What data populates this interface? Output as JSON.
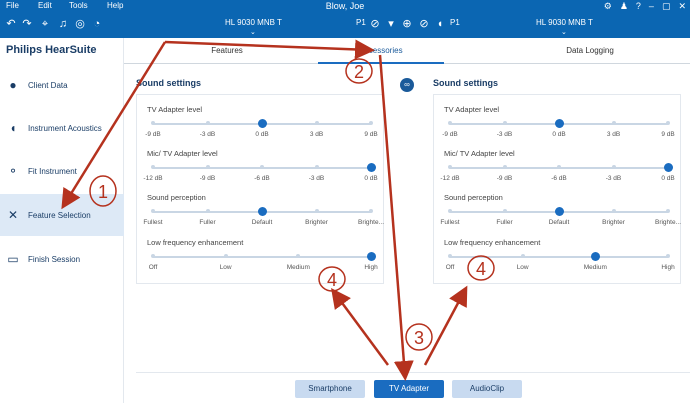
{
  "menubar": {
    "items": [
      "File",
      "Edit",
      "Tools",
      "Help"
    ],
    "title": "Blow, Joe"
  },
  "toolbar": {
    "left_device": "HL 9030 MNB T",
    "right_device": "HL 9030 MNB T",
    "left_program": "P1",
    "right_program": "P1"
  },
  "sidebar": {
    "brand": "Philips HearSuite",
    "items": [
      {
        "label": "Client Data",
        "icon": "person-icon"
      },
      {
        "label": "Instrument Acoustics",
        "icon": "ear-icon"
      },
      {
        "label": "Fit Instrument",
        "icon": "fit-icon"
      },
      {
        "label": "Feature Selection",
        "icon": "tools-icon"
      },
      {
        "label": "Finish Session",
        "icon": "monitor-icon"
      }
    ]
  },
  "tabs": [
    {
      "label": "Features"
    },
    {
      "label": "Accessories"
    },
    {
      "label": "Data Logging"
    }
  ],
  "panels": [
    {
      "title": "Sound settings",
      "groups": [
        {
          "label": "TV Adapter level",
          "ticks": [
            "-9 dB",
            "-3 dB",
            "0 dB",
            "3 dB",
            "9 dB"
          ],
          "selected": 2
        },
        {
          "label": "Mic/ TV Adapter level",
          "ticks": [
            "-12 dB",
            "-9 dB",
            "-6 dB",
            "-3 dB",
            "0 dB"
          ],
          "selected": 4
        },
        {
          "label": "Sound perception",
          "ticks": [
            "Fullest",
            "Fuller",
            "Default",
            "Brighter",
            "Brighte..."
          ],
          "selected": 2
        },
        {
          "label": "Low frequency enhancement",
          "ticks": [
            "Off",
            "Low",
            "Medium",
            "High"
          ],
          "selected": 3
        }
      ]
    },
    {
      "title": "Sound settings",
      "groups": [
        {
          "label": "TV Adapter level",
          "ticks": [
            "-9 dB",
            "-3 dB",
            "0 dB",
            "3 dB",
            "9 dB"
          ],
          "selected": 2
        },
        {
          "label": "Mic/ TV Adapter level",
          "ticks": [
            "-12 dB",
            "-9 dB",
            "-6 dB",
            "-3 dB",
            "0 dB"
          ],
          "selected": 4
        },
        {
          "label": "Sound perception",
          "ticks": [
            "Fullest",
            "Fuller",
            "Default",
            "Brighter",
            "Brighte..."
          ],
          "selected": 2
        },
        {
          "label": "Low frequency enhancement",
          "ticks": [
            "Off",
            "Low",
            "Medium",
            "High"
          ],
          "selected": 2
        }
      ]
    }
  ],
  "bottom_buttons": [
    {
      "label": "Smartphone"
    },
    {
      "label": "TV Adapter"
    },
    {
      "label": "AudioClip"
    }
  ],
  "annotations": [
    "1",
    "2",
    "3",
    "4",
    "4"
  ],
  "colors": {
    "brand_blue": "#0b66b2",
    "accent": "#1a6cc0",
    "annotation_red": "#b5321e"
  }
}
